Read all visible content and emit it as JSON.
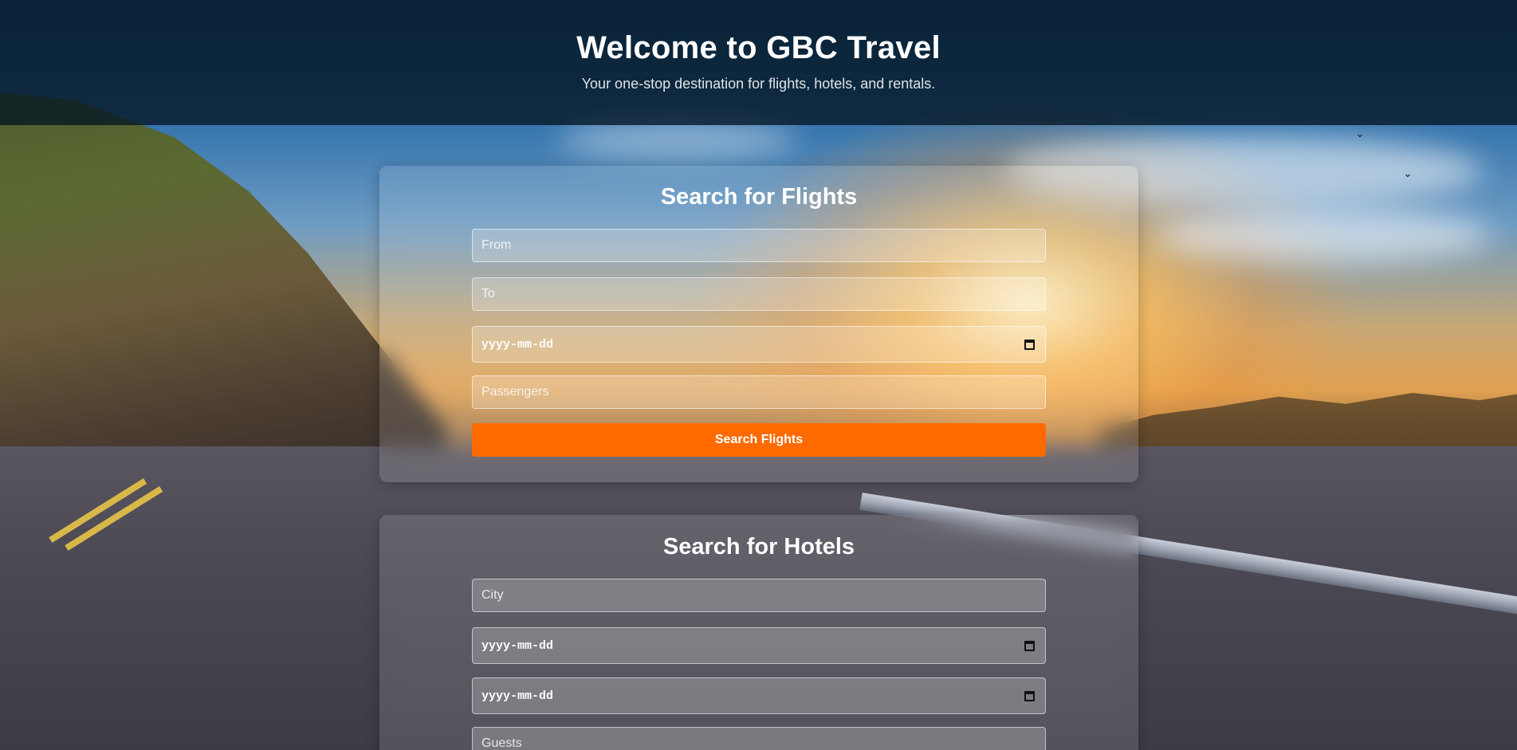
{
  "header": {
    "title": "Welcome to GBC Travel",
    "subtitle": "Your one-stop destination for flights, hotels, and rentals."
  },
  "flights": {
    "heading": "Search for Flights",
    "from_placeholder": "From",
    "to_placeholder": "To",
    "date_placeholder": "yyyy-mm-dd",
    "passengers_placeholder": "Passengers",
    "submit_label": "Search Flights"
  },
  "hotels": {
    "heading": "Search for Hotels",
    "city_placeholder": "City",
    "checkin_placeholder": "yyyy-mm-dd",
    "checkout_placeholder": "yyyy-mm-dd",
    "guests_placeholder": "Guests"
  },
  "icons": {
    "date_picker": "calendar-icon"
  },
  "colors": {
    "accent": "#ff6a00",
    "header_overlay": "#041624",
    "text_primary": "#ffffff"
  }
}
